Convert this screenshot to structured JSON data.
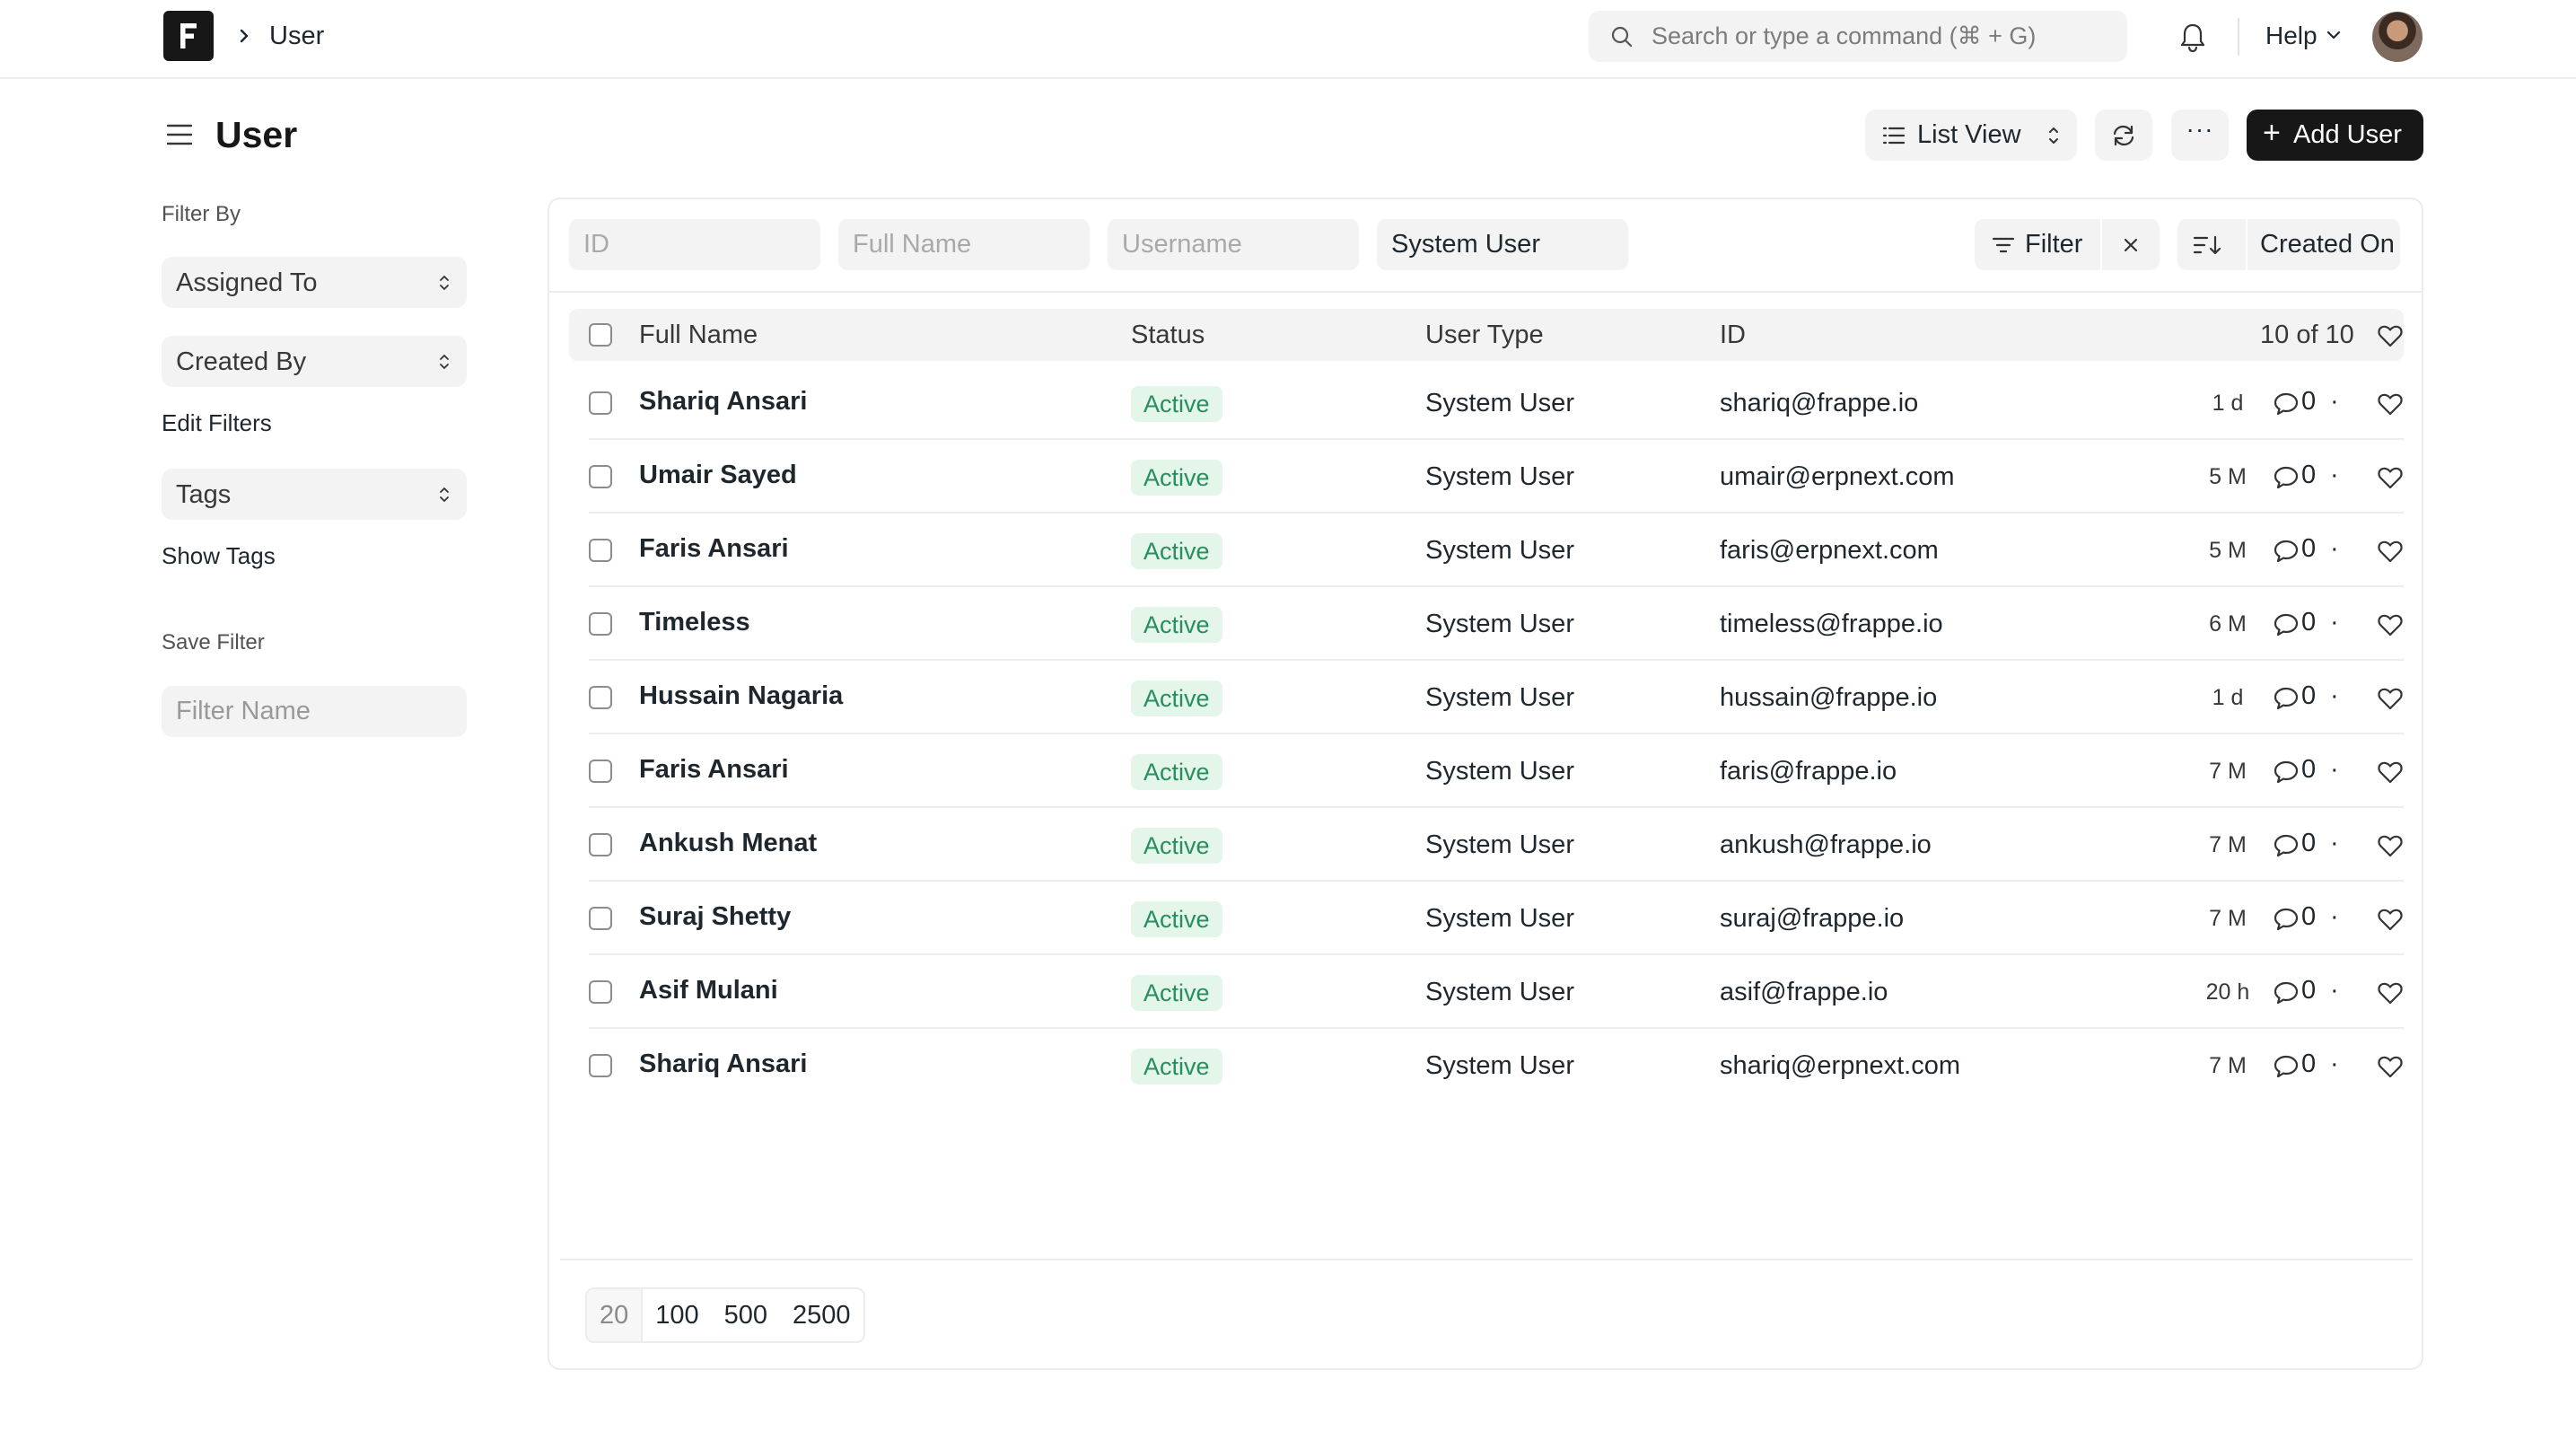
{
  "navbar": {
    "breadcrumb": "User",
    "search_placeholder": "Search or type a command (⌘ + G)",
    "help_label": "Help"
  },
  "page": {
    "title": "User",
    "list_view_label": "List View",
    "more_label": "···",
    "add_label": "Add User"
  },
  "sidebar": {
    "filter_by_label": "Filter By",
    "assigned_to": "Assigned To",
    "created_by": "Created By",
    "edit_filters": "Edit Filters",
    "tags": "Tags",
    "show_tags": "Show Tags",
    "save_filter_label": "Save Filter",
    "filter_name_placeholder": "Filter Name"
  },
  "filters": {
    "id_placeholder": "ID",
    "full_name_placeholder": "Full Name",
    "username_placeholder": "Username",
    "user_type_value": "System User",
    "filter_label": "Filter",
    "sort_label": "Created On"
  },
  "table": {
    "columns": [
      "Full Name",
      "Status",
      "User Type",
      "ID"
    ],
    "count": "10 of 10",
    "rows": [
      {
        "name": "Shariq Ansari",
        "status": "Active",
        "user_type": "System User",
        "id": "shariq@frappe.io",
        "age": "1 d",
        "comments": "0"
      },
      {
        "name": "Umair Sayed",
        "status": "Active",
        "user_type": "System User",
        "id": "umair@erpnext.com",
        "age": "5 M",
        "comments": "0"
      },
      {
        "name": "Faris Ansari",
        "status": "Active",
        "user_type": "System User",
        "id": "faris@erpnext.com",
        "age": "5 M",
        "comments": "0"
      },
      {
        "name": "Timeless",
        "status": "Active",
        "user_type": "System User",
        "id": "timeless@frappe.io",
        "age": "6 M",
        "comments": "0"
      },
      {
        "name": "Hussain Nagaria",
        "status": "Active",
        "user_type": "System User",
        "id": "hussain@frappe.io",
        "age": "1 d",
        "comments": "0"
      },
      {
        "name": "Faris Ansari",
        "status": "Active",
        "user_type": "System User",
        "id": "faris@frappe.io",
        "age": "7 M",
        "comments": "0"
      },
      {
        "name": "Ankush Menat",
        "status": "Active",
        "user_type": "System User",
        "id": "ankush@frappe.io",
        "age": "7 M",
        "comments": "0"
      },
      {
        "name": "Suraj Shetty",
        "status": "Active",
        "user_type": "System User",
        "id": "suraj@frappe.io",
        "age": "7 M",
        "comments": "0"
      },
      {
        "name": "Asif Mulani",
        "status": "Active",
        "user_type": "System User",
        "id": "asif@frappe.io",
        "age": "20 h",
        "comments": "0"
      },
      {
        "name": "Shariq Ansari",
        "status": "Active",
        "user_type": "System User",
        "id": "shariq@erpnext.com",
        "age": "7 M",
        "comments": "0"
      }
    ]
  },
  "pagination": {
    "page_sizes": [
      "20",
      "100",
      "500",
      "2500"
    ],
    "selected": "20"
  },
  "colors": {
    "primary_button": "#171717",
    "active_badge_bg": "#e4f5e9",
    "active_badge_text": "#278f5e",
    "control_bg": "#f3f3f3"
  },
  "icons": {
    "logo": "frappe-logo-icon",
    "search": "search-icon",
    "notifications": "bell-icon",
    "sidebar_toggle": "hamburger-icon",
    "list_view": "list-icon",
    "refresh": "refresh-icon",
    "filter": "filter-icon",
    "clear": "close-icon",
    "sort": "sort-icon",
    "comment": "comment-icon",
    "like": "heart-icon"
  }
}
